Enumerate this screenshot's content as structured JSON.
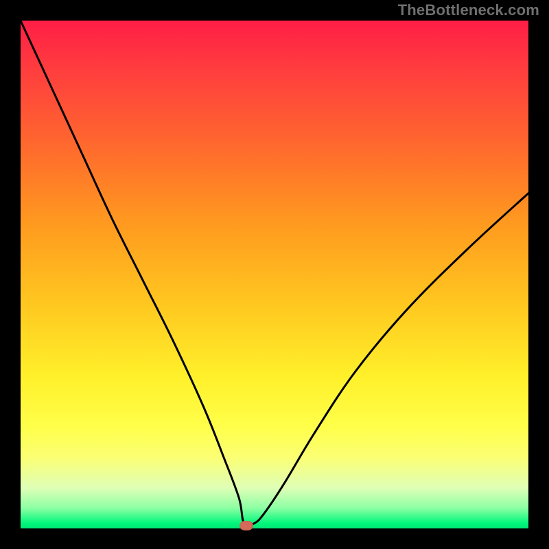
{
  "watermark": "TheBottleneck.com",
  "chart_data": {
    "type": "line",
    "title": "",
    "xlabel": "",
    "ylabel": "",
    "xlim": [
      0,
      100
    ],
    "ylim": [
      0,
      100
    ],
    "grid": false,
    "legend": false,
    "background": "rainbow-vertical-gradient",
    "series": [
      {
        "name": "bottleneck-curve",
        "x": [
          0,
          6,
          12,
          18,
          24,
          30,
          36,
          40,
          43,
          44,
          46,
          48,
          52,
          58,
          66,
          76,
          88,
          100
        ],
        "y": [
          100,
          87,
          74,
          61,
          49,
          37,
          24,
          14,
          6,
          1,
          1,
          3,
          9,
          19,
          31,
          43,
          55,
          66
        ]
      }
    ],
    "marker": {
      "x": 44.5,
      "y": 0.5,
      "color": "#d46a5a",
      "shape": "pill"
    },
    "gradient_stops": [
      {
        "pos": 0,
        "color": "#ff1e46"
      },
      {
        "pos": 10,
        "color": "#ff3e3e"
      },
      {
        "pos": 25,
        "color": "#ff6a2d"
      },
      {
        "pos": 40,
        "color": "#ff9a1f"
      },
      {
        "pos": 55,
        "color": "#ffc51f"
      },
      {
        "pos": 70,
        "color": "#fff02a"
      },
      {
        "pos": 80,
        "color": "#ffff4a"
      },
      {
        "pos": 86,
        "color": "#fbff73"
      },
      {
        "pos": 92,
        "color": "#dfffb6"
      },
      {
        "pos": 96,
        "color": "#8cffa4"
      },
      {
        "pos": 99,
        "color": "#00f77b"
      },
      {
        "pos": 100,
        "color": "#00e776"
      }
    ]
  }
}
